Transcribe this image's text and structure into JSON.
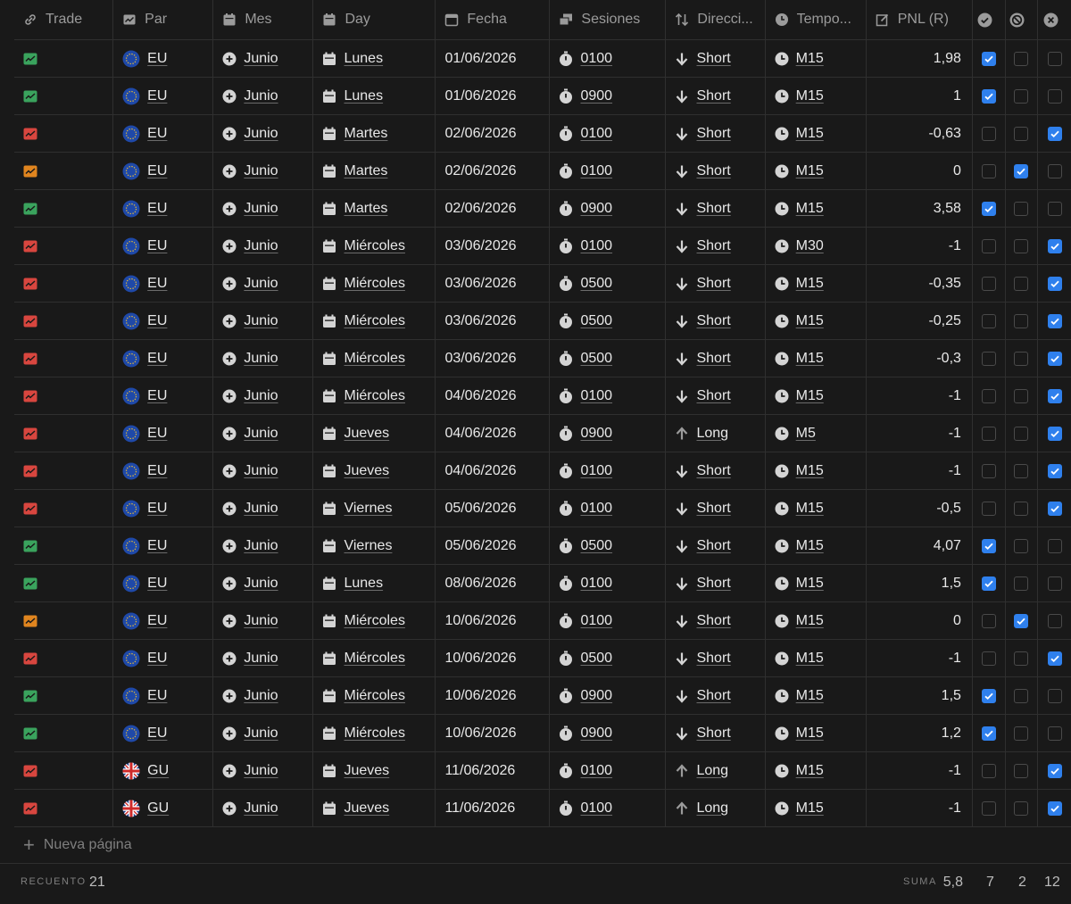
{
  "headers": {
    "trade": "Trade",
    "par": "Par",
    "mes": "Mes",
    "day": "Day",
    "fecha": "Fecha",
    "sesiones": "Sesiones",
    "direccion": "Direcci...",
    "tempo": "Tempo...",
    "pnl": "PNL (R)"
  },
  "colors": {
    "win": "#3aa35d",
    "loss": "#d8463f",
    "be": "#e0851f",
    "check": "#2f80ed"
  },
  "rows": [
    {
      "result": "win",
      "par": "EU",
      "mes": "Junio",
      "day": "Lunes",
      "fecha": "01/06/2026",
      "sesion": "0100",
      "dir": "Short",
      "tempo": "M15",
      "pnl": "1,98",
      "ck": [
        true,
        false,
        false
      ]
    },
    {
      "result": "win",
      "par": "EU",
      "mes": "Junio",
      "day": "Lunes",
      "fecha": "01/06/2026",
      "sesion": "0900",
      "dir": "Short",
      "tempo": "M15",
      "pnl": "1",
      "ck": [
        true,
        false,
        false
      ]
    },
    {
      "result": "loss",
      "par": "EU",
      "mes": "Junio",
      "day": "Martes",
      "fecha": "02/06/2026",
      "sesion": "0100",
      "dir": "Short",
      "tempo": "M15",
      "pnl": "-0,63",
      "ck": [
        false,
        false,
        true
      ]
    },
    {
      "result": "be",
      "par": "EU",
      "mes": "Junio",
      "day": "Martes",
      "fecha": "02/06/2026",
      "sesion": "0100",
      "dir": "Short",
      "tempo": "M15",
      "pnl": "0",
      "ck": [
        false,
        true,
        false
      ]
    },
    {
      "result": "win",
      "par": "EU",
      "mes": "Junio",
      "day": "Martes",
      "fecha": "02/06/2026",
      "sesion": "0900",
      "dir": "Short",
      "tempo": "M15",
      "pnl": "3,58",
      "ck": [
        true,
        false,
        false
      ]
    },
    {
      "result": "loss",
      "par": "EU",
      "mes": "Junio",
      "day": "Miércoles",
      "fecha": "03/06/2026",
      "sesion": "0100",
      "dir": "Short",
      "tempo": "M30",
      "pnl": "-1",
      "ck": [
        false,
        false,
        true
      ]
    },
    {
      "result": "loss",
      "par": "EU",
      "mes": "Junio",
      "day": "Miércoles",
      "fecha": "03/06/2026",
      "sesion": "0500",
      "dir": "Short",
      "tempo": "M15",
      "pnl": "-0,35",
      "ck": [
        false,
        false,
        true
      ]
    },
    {
      "result": "loss",
      "par": "EU",
      "mes": "Junio",
      "day": "Miércoles",
      "fecha": "03/06/2026",
      "sesion": "0500",
      "dir": "Short",
      "tempo": "M15",
      "pnl": "-0,25",
      "ck": [
        false,
        false,
        true
      ]
    },
    {
      "result": "loss",
      "par": "EU",
      "mes": "Junio",
      "day": "Miércoles",
      "fecha": "03/06/2026",
      "sesion": "0500",
      "dir": "Short",
      "tempo": "M15",
      "pnl": "-0,3",
      "ck": [
        false,
        false,
        true
      ]
    },
    {
      "result": "loss",
      "par": "EU",
      "mes": "Junio",
      "day": "Miércoles",
      "fecha": "04/06/2026",
      "sesion": "0100",
      "dir": "Short",
      "tempo": "M15",
      "pnl": "-1",
      "ck": [
        false,
        false,
        true
      ]
    },
    {
      "result": "loss",
      "par": "EU",
      "mes": "Junio",
      "day": "Jueves",
      "fecha": "04/06/2026",
      "sesion": "0900",
      "dir": "Long",
      "tempo": "M5",
      "pnl": "-1",
      "ck": [
        false,
        false,
        true
      ]
    },
    {
      "result": "loss",
      "par": "EU",
      "mes": "Junio",
      "day": "Jueves",
      "fecha": "04/06/2026",
      "sesion": "0100",
      "dir": "Short",
      "tempo": "M15",
      "pnl": "-1",
      "ck": [
        false,
        false,
        true
      ]
    },
    {
      "result": "loss",
      "par": "EU",
      "mes": "Junio",
      "day": "Viernes",
      "fecha": "05/06/2026",
      "sesion": "0100",
      "dir": "Short",
      "tempo": "M15",
      "pnl": "-0,5",
      "ck": [
        false,
        false,
        true
      ]
    },
    {
      "result": "win",
      "par": "EU",
      "mes": "Junio",
      "day": "Viernes",
      "fecha": "05/06/2026",
      "sesion": "0500",
      "dir": "Short",
      "tempo": "M15",
      "pnl": "4,07",
      "ck": [
        true,
        false,
        false
      ]
    },
    {
      "result": "win",
      "par": "EU",
      "mes": "Junio",
      "day": "Lunes",
      "fecha": "08/06/2026",
      "sesion": "0100",
      "dir": "Short",
      "tempo": "M15",
      "pnl": "1,5",
      "ck": [
        true,
        false,
        false
      ]
    },
    {
      "result": "be",
      "par": "EU",
      "mes": "Junio",
      "day": "Miércoles",
      "fecha": "10/06/2026",
      "sesion": "0100",
      "dir": "Short",
      "tempo": "M15",
      "pnl": "0",
      "ck": [
        false,
        true,
        false
      ]
    },
    {
      "result": "loss",
      "par": "EU",
      "mes": "Junio",
      "day": "Miércoles",
      "fecha": "10/06/2026",
      "sesion": "0500",
      "dir": "Short",
      "tempo": "M15",
      "pnl": "-1",
      "ck": [
        false,
        false,
        true
      ]
    },
    {
      "result": "win",
      "par": "EU",
      "mes": "Junio",
      "day": "Miércoles",
      "fecha": "10/06/2026",
      "sesion": "0900",
      "dir": "Short",
      "tempo": "M15",
      "pnl": "1,5",
      "ck": [
        true,
        false,
        false
      ]
    },
    {
      "result": "win",
      "par": "EU",
      "mes": "Junio",
      "day": "Miércoles",
      "fecha": "10/06/2026",
      "sesion": "0900",
      "dir": "Short",
      "tempo": "M15",
      "pnl": "1,2",
      "ck": [
        true,
        false,
        false
      ]
    },
    {
      "result": "loss",
      "par": "GU",
      "mes": "Junio",
      "day": "Jueves",
      "fecha": "11/06/2026",
      "sesion": "0100",
      "dir": "Long",
      "tempo": "M15",
      "pnl": "-1",
      "ck": [
        false,
        false,
        true
      ]
    },
    {
      "result": "loss",
      "par": "GU",
      "mes": "Junio",
      "day": "Jueves",
      "fecha": "11/06/2026",
      "sesion": "0100",
      "dir": "Long",
      "tempo": "M15",
      "pnl": "-1",
      "ck": [
        false,
        false,
        true
      ]
    }
  ],
  "new_page": "Nueva página",
  "footer": {
    "count_label": "RECUENTO",
    "count_value": "21",
    "sum_label": "SUMA",
    "sum_value": "5,8",
    "ck1_total": "7",
    "ck2_total": "2",
    "ck3_total": "12"
  }
}
